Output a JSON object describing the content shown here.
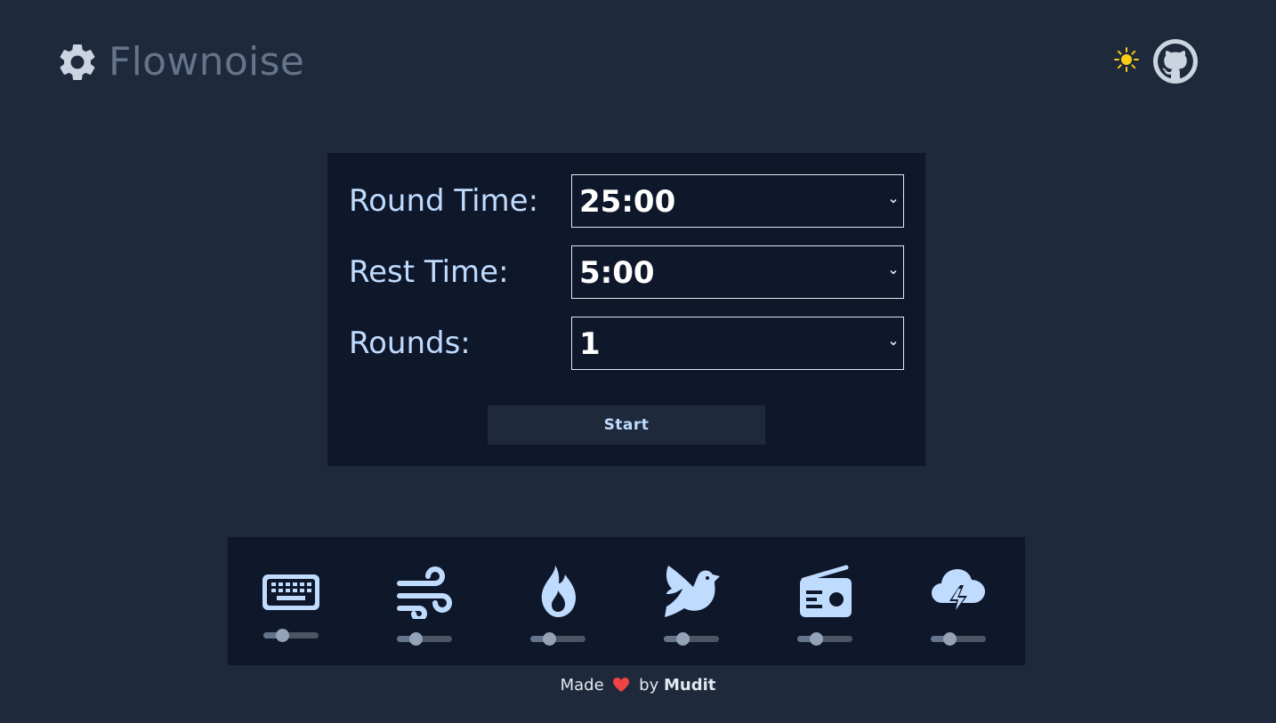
{
  "app": {
    "title": "Flownoise",
    "icon": "gear-icon"
  },
  "header": {
    "theme_toggle_icon": "sun-icon",
    "github_icon": "github-icon"
  },
  "timer": {
    "round_time_label": "Round Time:",
    "round_time_value": "25:00",
    "rest_time_label": "Rest Time:",
    "rest_time_value": "5:00",
    "rounds_label": "Rounds:",
    "rounds_value": "1",
    "start_label": "Start"
  },
  "sounds": [
    {
      "icon": "keyboard-icon",
      "volume": 0.3
    },
    {
      "icon": "wind-icon",
      "volume": 0.3
    },
    {
      "icon": "fire-icon",
      "volume": 0.3
    },
    {
      "icon": "bird-icon",
      "volume": 0.3
    },
    {
      "icon": "radio-icon",
      "volume": 0.3
    },
    {
      "icon": "thunderstorm-icon",
      "volume": 0.3
    }
  ],
  "footer": {
    "made": "Made",
    "by": "by",
    "author": "Mudit"
  },
  "colors": {
    "background": "#1e293b",
    "panel": "#0f172a",
    "accent": "#bfdbfe",
    "heart": "#ef4444",
    "sun": "#facc15"
  }
}
